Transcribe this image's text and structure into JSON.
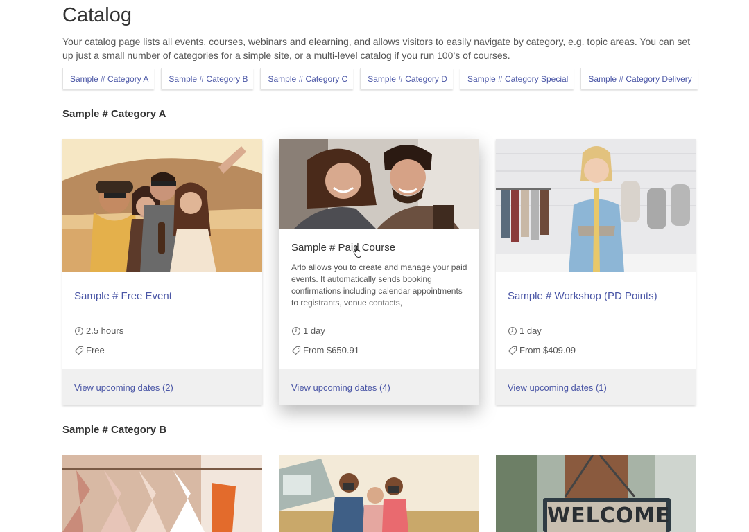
{
  "page": {
    "title": "Catalog",
    "intro": "Your catalog page lists all events, courses, webinars and elearning, and allows visitors to easily navigate by category, e.g. topic areas. You can set up just a small number of categories for a simple site, or a multi-level catalog if you run 100’s of courses."
  },
  "categories": [
    {
      "label": "Sample # Category A"
    },
    {
      "label": "Sample # Category B"
    },
    {
      "label": "Sample # Category C"
    },
    {
      "label": "Sample # Category D"
    },
    {
      "label": "Sample # Category Special"
    },
    {
      "label": "Sample # Category Delivery"
    }
  ],
  "sections": [
    {
      "heading": "Sample # Category A",
      "cards": [
        {
          "title": "Sample # Free Event",
          "duration": "2.5 hours",
          "price": "Free",
          "link": "View upcoming dates (2)",
          "image": "group-selfie-car-photo"
        },
        {
          "title": "Sample # Paid Course",
          "description": "Arlo allows you to create and manage your paid events. It automatically sends booking confirmations including calendar appointments to registrants, venue contacts,",
          "duration": "1 day",
          "price": "From $650.91",
          "link": "View upcoming dates (4)",
          "image": "couple-laughing-photo"
        },
        {
          "title": "Sample # Workshop (PD Points)",
          "duration": "1 day",
          "price": "From $409.09",
          "link": "View upcoming dates (1)",
          "image": "tailor-workshop-photo"
        }
      ]
    },
    {
      "heading": "Sample # Category B",
      "images": [
        "clothes-rack-photo",
        "kids-camera-photo",
        "welcome-sign-photo"
      ],
      "welcome_sign": "WELCOME"
    }
  ],
  "colors": {
    "link": "#4a56a6",
    "footer_bg": "#f0f0f0",
    "text": "#333333"
  }
}
